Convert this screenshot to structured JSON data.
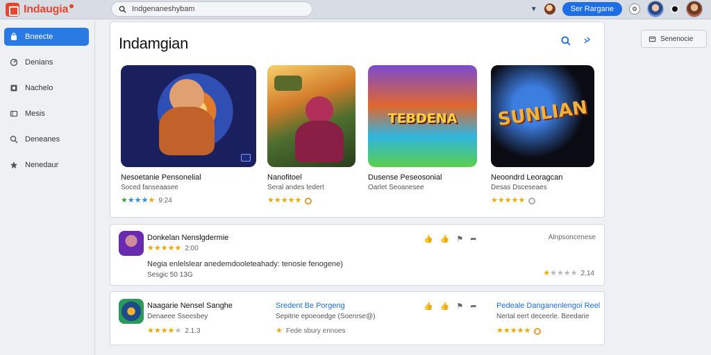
{
  "app": {
    "name": "Indaugia"
  },
  "search": {
    "value": "Indgenaneshybam"
  },
  "header": {
    "signin_label": "Ser Rargane"
  },
  "sidebar": {
    "items": [
      {
        "label": "Bneecte",
        "icon": "bag-icon",
        "active": true
      },
      {
        "label": "Denians",
        "icon": "tag-icon"
      },
      {
        "label": "Nachelo",
        "icon": "bookmark-icon"
      },
      {
        "label": "Mesis",
        "icon": "film-icon"
      },
      {
        "label": "Deneanes",
        "icon": "map-pin-icon"
      },
      {
        "label": "Nenedaur",
        "icon": "star-icon"
      }
    ]
  },
  "panel": {
    "title": "Indamgian",
    "games": [
      {
        "name": "Nesoetanie Pensonelial",
        "sub": "Soced fanseaasee",
        "rating_text": "9:24",
        "stars": 5,
        "art_text": ""
      },
      {
        "name": "Nanofitoel",
        "sub": "Seral andes tedert",
        "rating_text": "",
        "stars": 5,
        "art_text": ""
      },
      {
        "name": "Dusense Peseosonial",
        "sub": "Oarlet Seoanesee",
        "rating_text": "",
        "stars": 0,
        "art_text": "TEBDENA"
      },
      {
        "name": "Neoondrd Leoragcan",
        "sub": "Desas Dsceseaes",
        "rating_text": "",
        "stars": 5,
        "art_text": "SUNLIAN"
      }
    ]
  },
  "side_button": {
    "label": "Senenocie"
  },
  "reviews": [
    {
      "title": "Donkelan Nenslgdermie",
      "rating_text": "2:00",
      "text": "Negia enlelslear anedemdooleteahady: tenosie fenogene)",
      "sub": "Sesgic  50 13G",
      "date": "Alnpsoncenese",
      "score_text": "2.14"
    },
    {
      "title": "Naagarie Nensel Sanghe",
      "sub": "Denaeee Sseesbey",
      "rating_text": "2.1.3",
      "link": "Sredent Be Porgeng",
      "link_sub": "Sepitrie epoeoedge (Soenrse@)",
      "link_meta": "Fede sbury ennoes",
      "link2": "Pedeale Danganenlengoi Reel",
      "link2_sub": "Nertal eert deceerle. Beedarie"
    }
  ],
  "colors": {
    "accent": "#1e6fe6",
    "brand": "#e8452f",
    "star": "#f0a800"
  }
}
